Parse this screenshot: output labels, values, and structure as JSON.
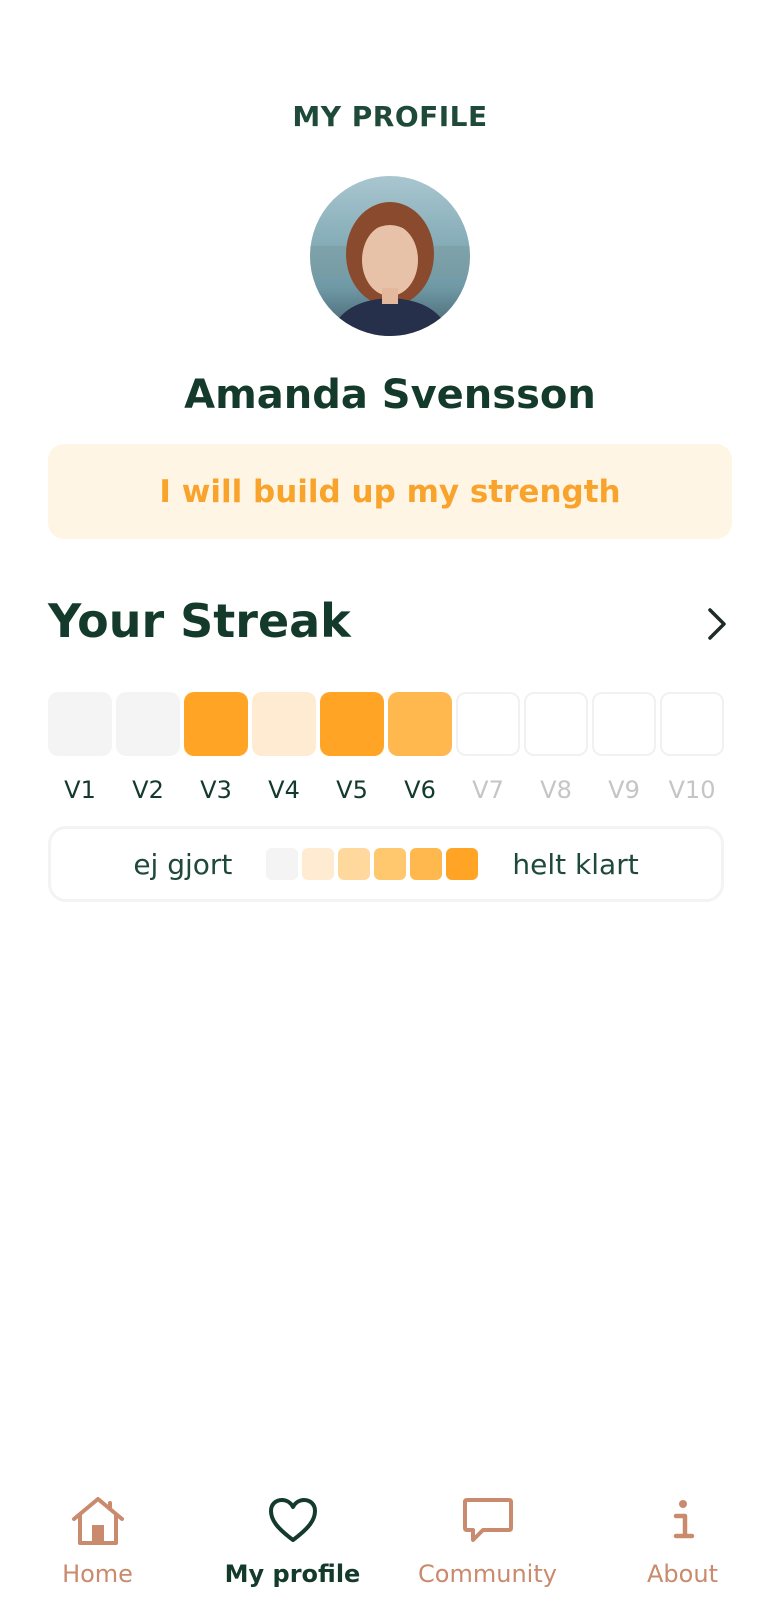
{
  "header": {
    "title": "MY PROFILE"
  },
  "profile": {
    "name": "Amanda Svensson",
    "goal": "I will build up my strength"
  },
  "streak": {
    "heading": "Your Streak",
    "weeks": [
      {
        "label": "V1",
        "level": 0,
        "color": "#f5f4f4",
        "label_color": "#143a2c"
      },
      {
        "label": "V2",
        "level": 0,
        "color": "#f5f4f4",
        "label_color": "#143a2c"
      },
      {
        "label": "V3",
        "level": 5,
        "color": "#ffa425",
        "label_color": "#143a2c"
      },
      {
        "label": "V4",
        "level": 1,
        "color": "#ffebd2",
        "label_color": "#143a2c"
      },
      {
        "label": "V5",
        "level": 5,
        "color": "#ffa425",
        "label_color": "#143a2c"
      },
      {
        "label": "V6",
        "level": 4,
        "color": "#ffb84d",
        "label_color": "#143a2c"
      },
      {
        "label": "V7",
        "level": null,
        "color": "#ffffff",
        "label_color": "#c5c5c5"
      },
      {
        "label": "V8",
        "level": null,
        "color": "#ffffff",
        "label_color": "#c5c5c5"
      },
      {
        "label": "V9",
        "level": null,
        "color": "#ffffff",
        "label_color": "#c5c5c5"
      },
      {
        "label": "V10",
        "level": null,
        "color": "#ffffff",
        "label_color": "#c5c5c5"
      }
    ],
    "legend": {
      "low_label": "ej gjort",
      "high_label": "helt klart",
      "scale_colors": [
        "#f5f4f4",
        "#ffebd2",
        "#ffd89d",
        "#ffc76e",
        "#ffb84d",
        "#ffa425"
      ]
    }
  },
  "nav": {
    "items": [
      {
        "label": "Home",
        "icon": "home-icon",
        "active": false
      },
      {
        "label": "My profile",
        "icon": "heart-icon",
        "active": true
      },
      {
        "label": "Community",
        "icon": "chat-bubble-icon",
        "active": false
      },
      {
        "label": "About",
        "icon": "info-icon",
        "active": false
      }
    ]
  },
  "colors": {
    "accent": "#ffa425",
    "text_dark": "#143a2c",
    "nav_inactive": "#c98a6d"
  }
}
